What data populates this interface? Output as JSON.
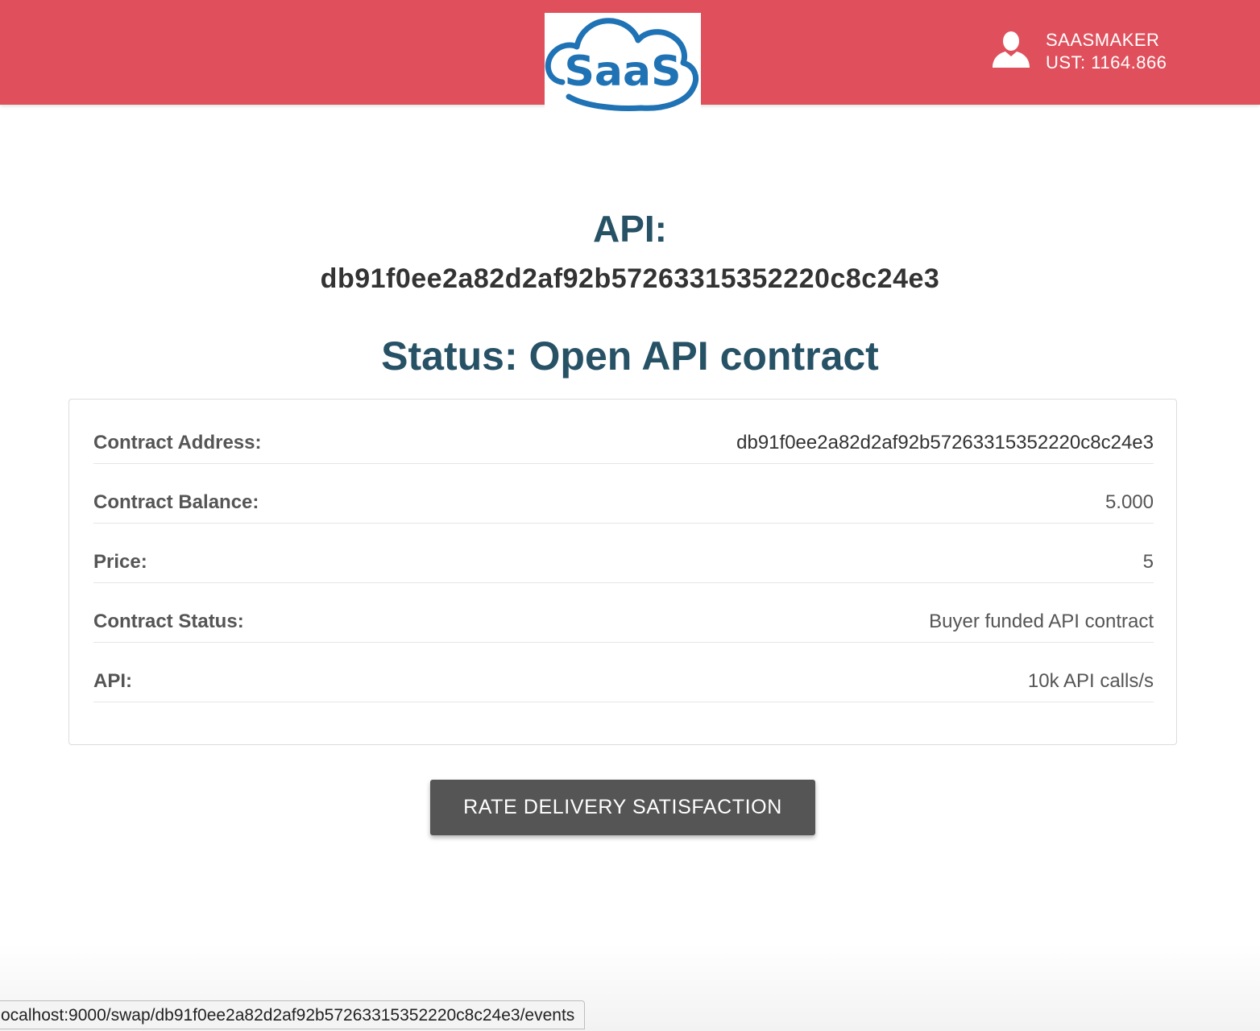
{
  "header": {
    "logo_text": "SaaS",
    "user_name": "SAASMAKER",
    "balance": "UST: 1164.866",
    "brand_color": "#e0505c",
    "logo_color": "#1f72b4",
    "user_icon": "user-icon"
  },
  "main": {
    "api_label": "API:",
    "api_id": "db91f0ee2a82d2af92b57263315352220c8c24e3",
    "status_title": "Status: Open API contract"
  },
  "details": {
    "rows": [
      {
        "label": "Contract Address:",
        "value": "db91f0ee2a82d2af92b57263315352220c8c24e3"
      },
      {
        "label": "Contract Balance:",
        "value": "5.000"
      },
      {
        "label": "Price:",
        "value": "5"
      },
      {
        "label": "Contract Status:",
        "value": "Buyer funded API contract"
      },
      {
        "label": "API:",
        "value": "10k API calls/s"
      }
    ]
  },
  "actions": {
    "rate_button_label": "RATE DELIVERY SATISFACTION"
  },
  "statusbar": {
    "url": "ocalhost:9000/swap/db91f0ee2a82d2af92b57263315352220c8c24e3/events"
  }
}
